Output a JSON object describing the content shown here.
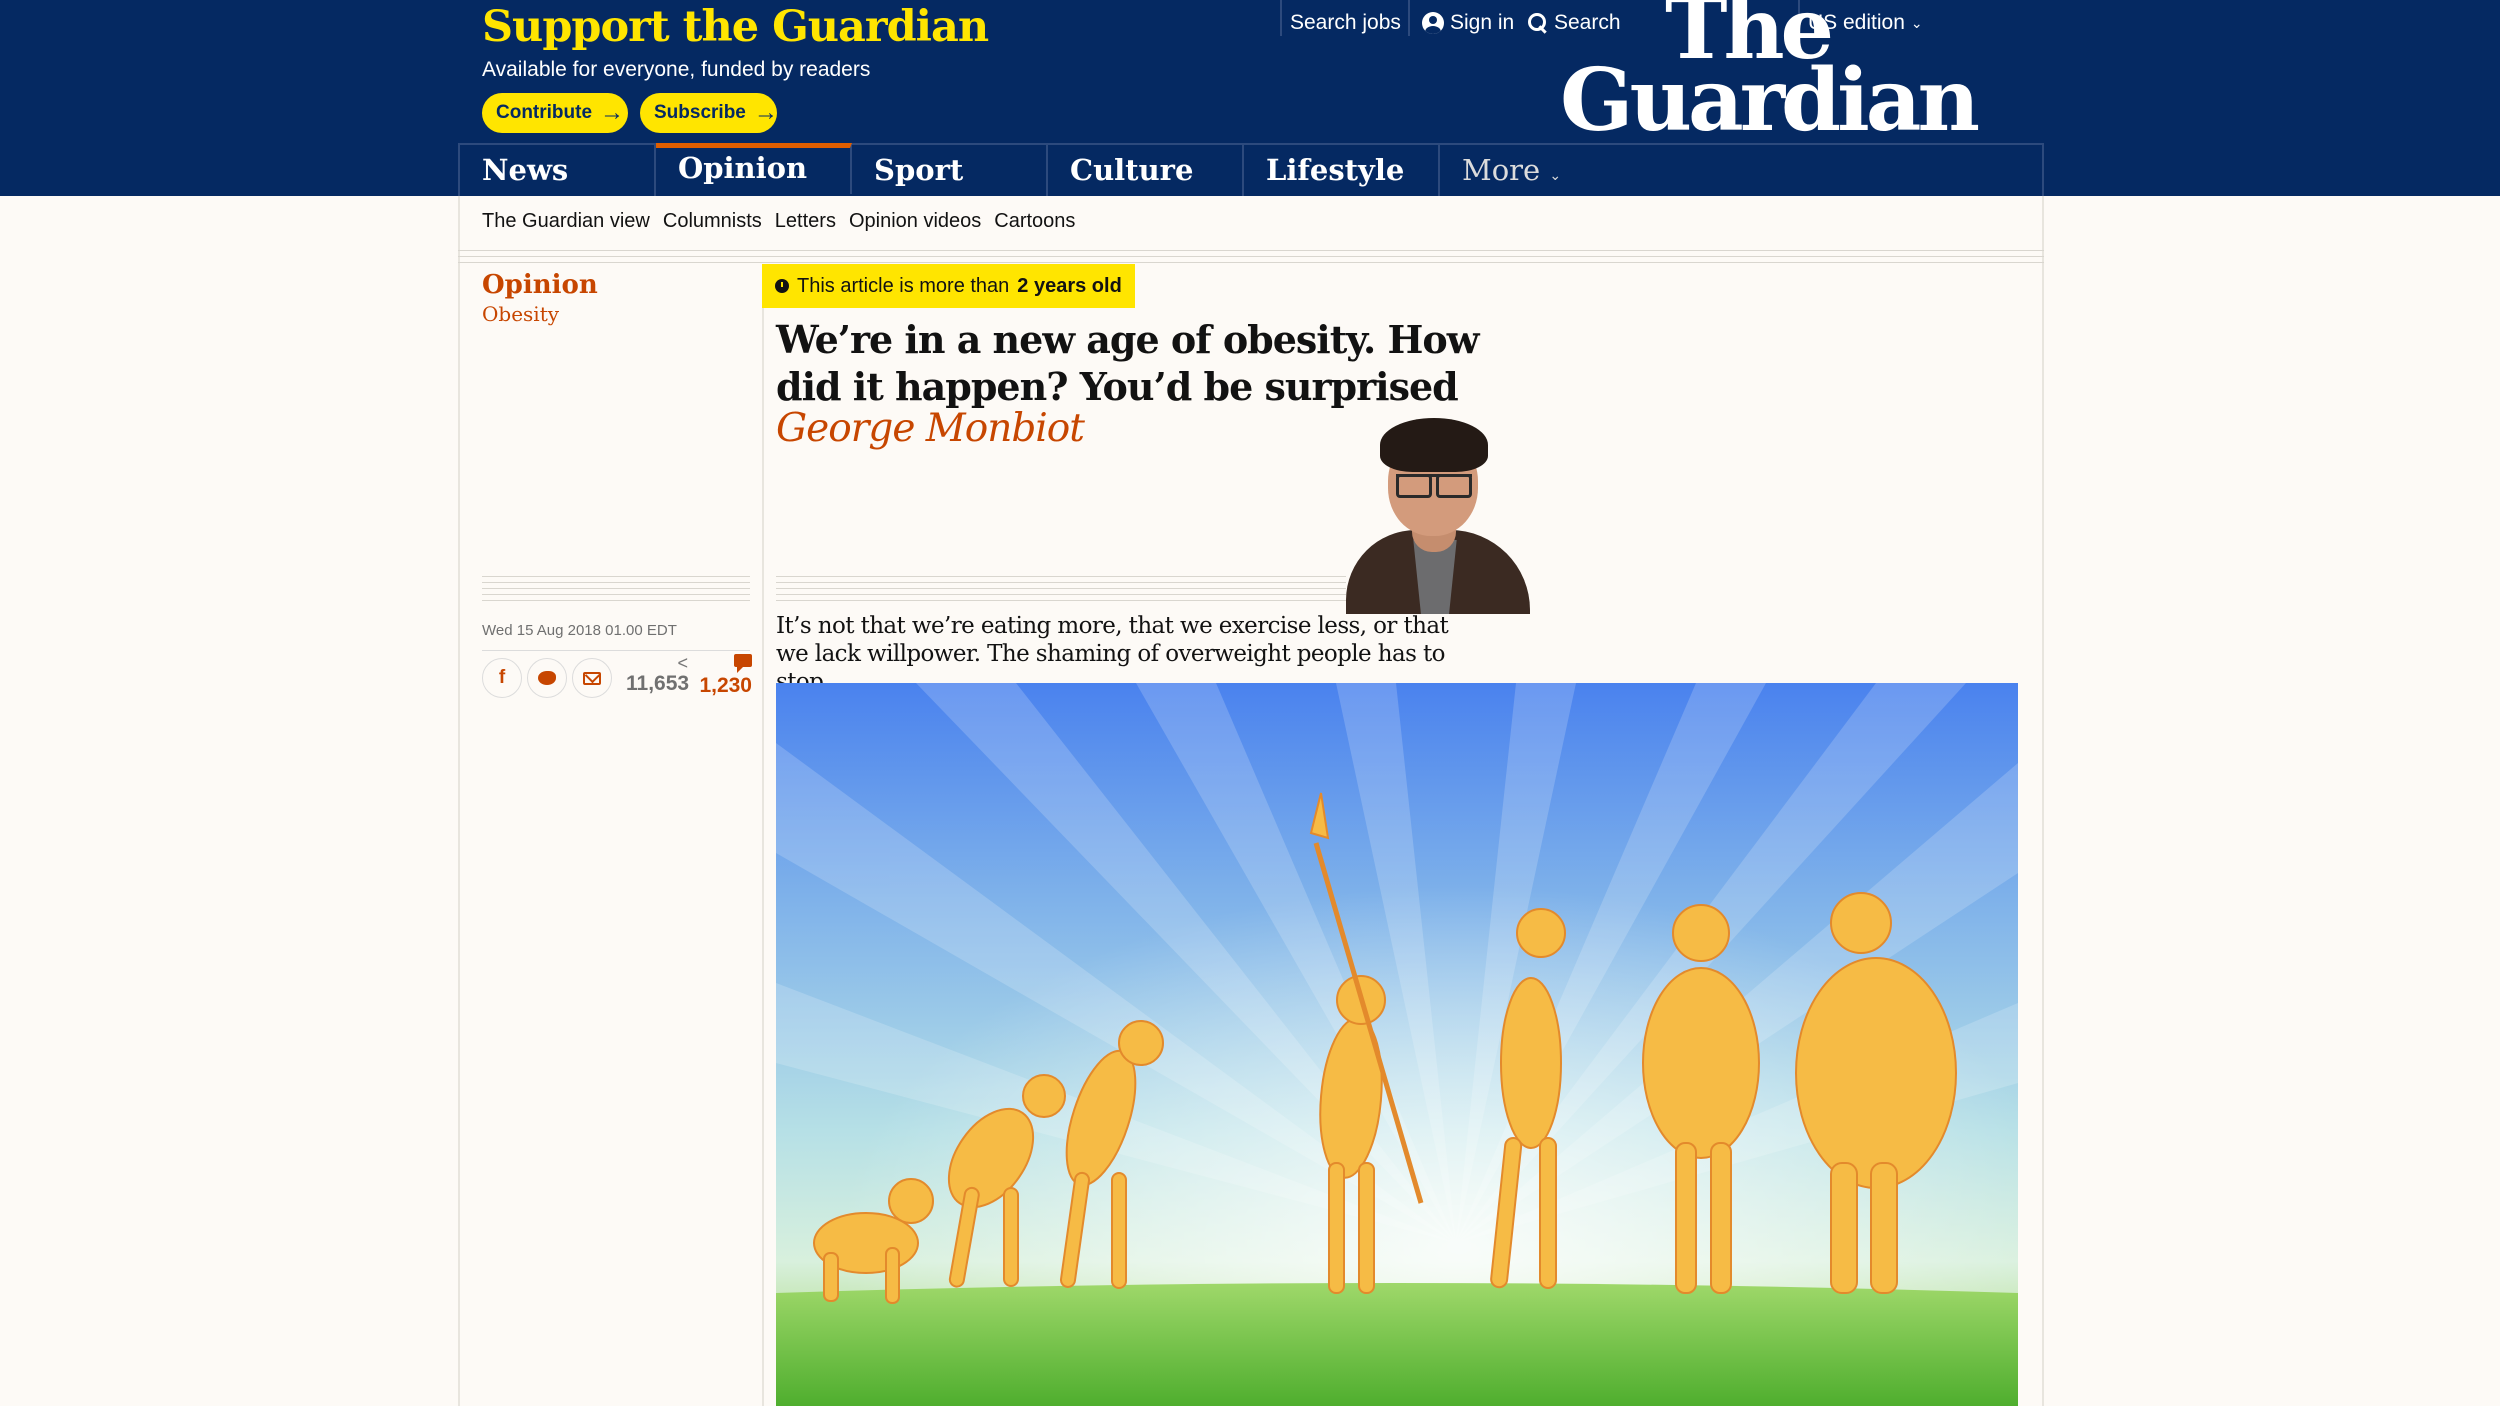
{
  "support": {
    "title": "Support the Guardian",
    "subtitle": "Available for everyone, funded by readers",
    "contribute_label": "Contribute",
    "subscribe_label": "Subscribe"
  },
  "top_links": {
    "search_jobs": "Search jobs",
    "sign_in": "Sign in",
    "search": "Search",
    "edition": "US edition"
  },
  "logo": {
    "line1": "The",
    "line2": "Guardian"
  },
  "nav": {
    "items": [
      {
        "label": "News"
      },
      {
        "label": "Opinion",
        "active": true
      },
      {
        "label": "Sport"
      },
      {
        "label": "Culture"
      },
      {
        "label": "Lifestyle"
      }
    ],
    "more_label": "More"
  },
  "subnav": [
    "The Guardian view",
    "Columnists",
    "Letters",
    "Opinion videos",
    "Cartoons"
  ],
  "article": {
    "section": "Opinion",
    "series": "Obesity",
    "age_notice_prefix": "This article is more than",
    "age_notice_bold": "2 years old",
    "headline": "We’re in a new age of obesity. How did it happen? You’d be surprised",
    "byline": "George Monbiot",
    "standfirst": "It’s not that we’re eating more, that we exercise less, or that we lack willpower. The shaming of overweight people has to stop",
    "dateline": "Wed 15 Aug 2018 01.00 EDT",
    "share_count": "11,653",
    "comment_count": "1,230"
  },
  "colors": {
    "brand_blue": "#052962",
    "support_yellow": "#ffe500",
    "opinion_orange": "#c74600",
    "nav_active_accent": "#e05e00"
  },
  "icons": {
    "facebook": "facebook-icon",
    "twitter": "twitter-icon",
    "email": "email-icon",
    "share": "share-icon",
    "comment": "comment-icon",
    "clock": "clock-icon",
    "user": "user-icon",
    "search": "search-icon"
  }
}
